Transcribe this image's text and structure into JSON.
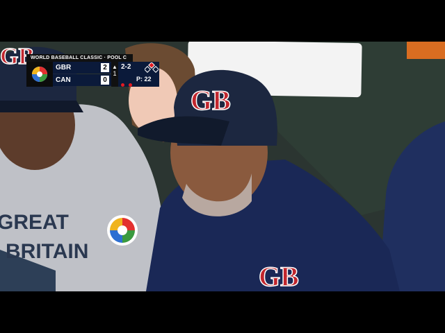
{
  "broadcast": {
    "event_title": "WORLD BASEBALL CLASSIC · POOL C"
  },
  "scoreboard": {
    "away": {
      "team": "GBR",
      "runs": "2"
    },
    "home": {
      "team": "CAN",
      "runs": "0"
    },
    "inning": "1",
    "count": "2-2",
    "pitch_count": "P: 22",
    "outs": 2,
    "bases": {
      "first": false,
      "second": true,
      "third": false
    }
  },
  "jersey": {
    "left_player_chest_text_line1": "GREAT",
    "left_player_chest_text_line2": "BRITAIN",
    "cap_logo": "GB"
  },
  "colors": {
    "navy": "#0b1a3a",
    "red": "#e21b22",
    "white": "#ffffff"
  }
}
